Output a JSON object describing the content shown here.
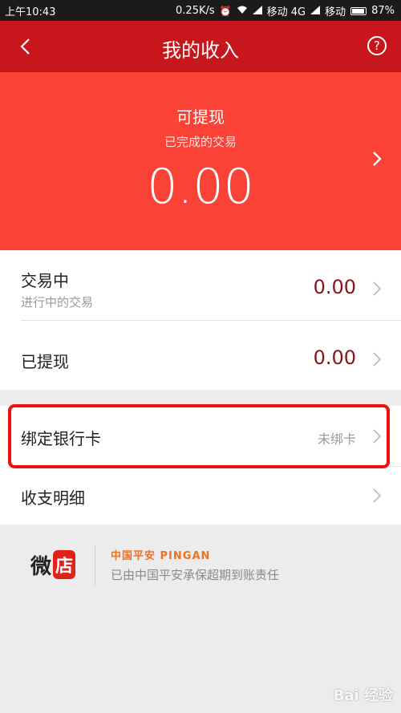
{
  "status_bar": {
    "time": "上午10:43",
    "speed": "0.25K/s",
    "carrier1": "移动 4G",
    "carrier2": "移动",
    "battery": "87%"
  },
  "nav": {
    "title": "我的收入",
    "help_glyph": "?"
  },
  "withdrawable": {
    "title": "可提现",
    "subtitle": "已完成的交易",
    "amount": "0.00"
  },
  "rows": {
    "trading": {
      "title": "交易中",
      "subtitle": "进行中的交易",
      "amount": "0.00"
    },
    "withdrawn": {
      "title": "已提现",
      "amount": "0.00"
    },
    "bind_card": {
      "title": "绑定银行卡",
      "status": "未绑卡"
    },
    "details": {
      "title": "收支明细"
    }
  },
  "footer": {
    "logo_wei": "微",
    "logo_dian": "店",
    "pingan_brand": "中国平安 PINGAN",
    "pingan_text": "已由中国平安承保超期到账责任"
  },
  "watermark": "Bai 经验",
  "colors": {
    "nav_bg": "#c8161d",
    "hero_bg": "#fa4236",
    "amount_text": "#8b1418",
    "highlight_border": "#ee1010"
  }
}
